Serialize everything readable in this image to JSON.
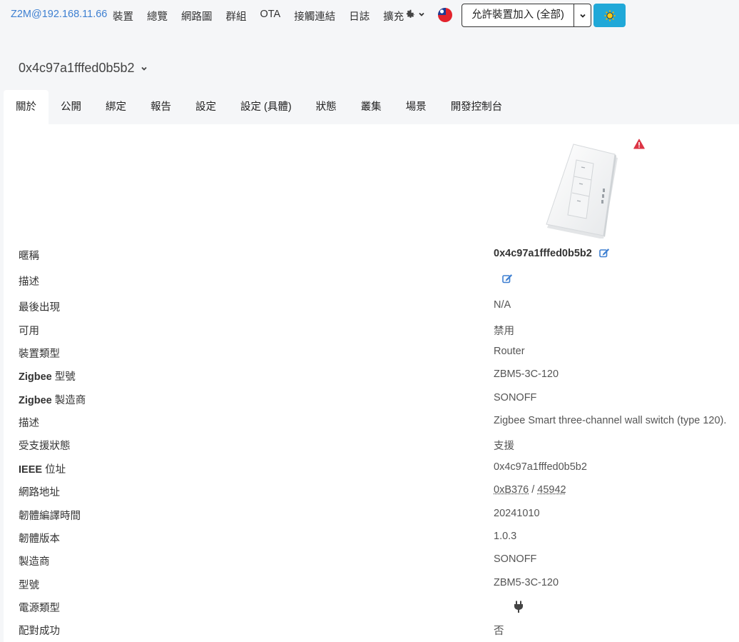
{
  "nav": {
    "brand": "Z2M@192.168.11.66",
    "links": [
      "裝置",
      "總覽",
      "網路圖",
      "群組",
      "OTA",
      "接觸連結",
      "日誌",
      "擴充"
    ],
    "permit_join": "允許裝置加入 (全部)"
  },
  "device": {
    "title": "0x4c97a1fffed0b5b2"
  },
  "tabs": [
    "關於",
    "公開",
    "綁定",
    "報告",
    "設定",
    "設定 (具體)",
    "狀態",
    "叢集",
    "場景",
    "開發控制台"
  ],
  "details": {
    "friendly_name_label": "暱稱",
    "friendly_name_value": "0x4c97a1fffed0b5b2",
    "description_label": "描述",
    "last_seen_label": "最後出現",
    "last_seen_value": "N/A",
    "availability_label": "可用",
    "availability_value": "禁用",
    "device_type_label": "裝置類型",
    "device_type_value": "Router",
    "zigbee_model_label_b": "Zigbee",
    "zigbee_model_label": " 型號",
    "zigbee_model_value": "ZBM5-3C-120",
    "zigbee_manufacturer_label_b": "Zigbee",
    "zigbee_manufacturer_label": " 製造商",
    "zigbee_manufacturer_value": "SONOFF",
    "description2_label": "描述",
    "description2_value": "Zigbee Smart three-channel wall switch (type 120).",
    "support_status_label": "受支援狀態",
    "support_status_value": "支援",
    "ieee_label_b": "IEEE",
    "ieee_label": " 位址",
    "ieee_value": "0x4c97a1fffed0b5b2",
    "network_address_label": "網路地址",
    "network_address_hex": "0xB376",
    "network_address_sep": " / ",
    "network_address_dec": "45942",
    "firmware_build_date_label": "韌體編譯時間",
    "firmware_build_date_value": "20241010",
    "firmware_version_label": "韌體版本",
    "firmware_version_value": "1.0.3",
    "manufacturer_label": "製造商",
    "manufacturer_value": "SONOFF",
    "model_label": "型號",
    "model_value": "ZBM5-3C-120",
    "power_source_label": "電源類型",
    "interview_label": "配對成功",
    "interview_value": "否"
  },
  "colors": {
    "link": "#3d7fd1",
    "success": "#3fab4e",
    "theme_button": "#20a8d8",
    "warning": "#dc3545"
  },
  "icons": [
    "gear-icon",
    "taiwan-flag-icon",
    "chevron-down-icon",
    "sun-icon",
    "warning-icon",
    "edit-icon",
    "plug-icon"
  ]
}
